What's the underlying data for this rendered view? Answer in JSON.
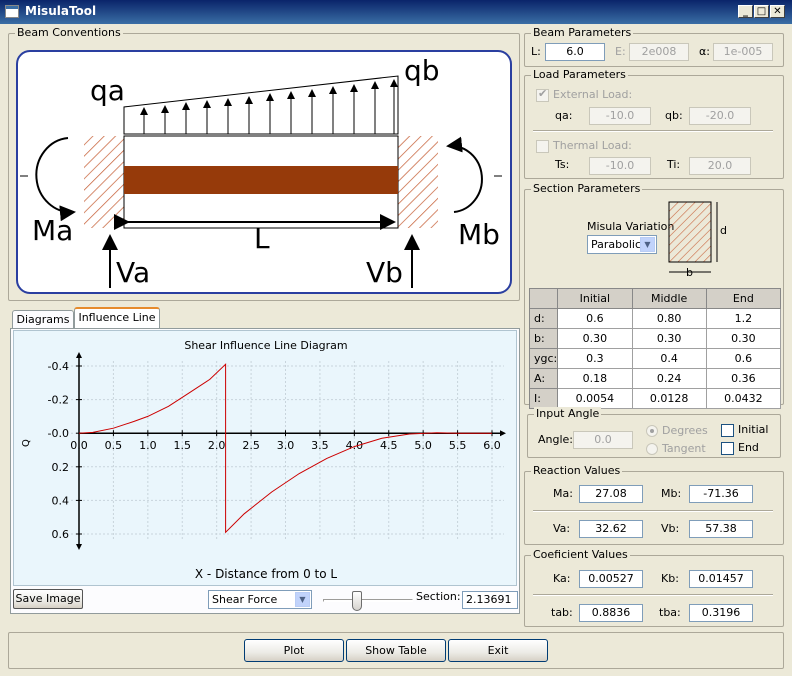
{
  "window": {
    "title": "MisulaTool"
  },
  "conventions": {
    "group_title": "Beam Conventions",
    "labels": {
      "qa": "qa",
      "qb": "qb",
      "Ma": "Ma",
      "Mb": "Mb",
      "L": "L",
      "Va": "Va",
      "Vb": "Vb"
    }
  },
  "tabs": [
    {
      "label": "Diagrams"
    },
    {
      "label": "Influence Line"
    }
  ],
  "chart_data": {
    "type": "line",
    "title": "Shear Influence Line Diagram",
    "xlabel": "X - Distance from 0 to L",
    "ylabel": "Q",
    "xlim": [
      0,
      6.0
    ],
    "ylim": [
      -0.4,
      0.6
    ],
    "y_inverted": true,
    "xticks": [
      0.0,
      0.5,
      1.0,
      1.5,
      2.0,
      2.5,
      3.0,
      3.5,
      4.0,
      4.5,
      5.0,
      5.5,
      6.0
    ],
    "xtick_labels": [
      "0.0",
      "0.5",
      "1.0",
      "1.5",
      "2.0",
      "2.5",
      "3.0",
      "3.5",
      "4.0",
      "4.5",
      "5.0",
      "5.5",
      "6.0"
    ],
    "yticks": [
      -0.4,
      -0.2,
      0.0,
      0.2,
      0.4,
      0.6
    ],
    "ytick_labels": [
      "-0.4",
      "-0.2",
      "-0.0",
      "0.2",
      "0.4",
      "0.6"
    ],
    "grid": true,
    "line_color": "#cc0000",
    "series": [
      {
        "x": [
          0.0,
          0.2,
          0.5,
          0.8,
          1.0,
          1.3,
          1.6,
          1.9,
          2.13,
          2.13,
          2.4,
          2.8,
          3.2,
          3.6,
          4.0,
          4.4,
          4.8,
          5.2,
          5.5,
          6.0
        ],
        "y": [
          0.0,
          -0.005,
          -0.03,
          -0.07,
          -0.1,
          -0.16,
          -0.24,
          -0.32,
          -0.41,
          0.59,
          0.48,
          0.35,
          0.24,
          0.15,
          0.08,
          0.03,
          0.005,
          -0.003,
          0.0,
          0.0
        ]
      }
    ]
  },
  "bottom_controls": {
    "save_image": "Save Image",
    "force_select": "Shear Force",
    "section_label": "Section:",
    "section_value": "2.13691",
    "slider_fraction": 0.36
  },
  "beam_params": {
    "title": "Beam Parameters",
    "L_label": "L:",
    "L_value": "6.0",
    "E_label": "E:",
    "E_value": "2e008",
    "alpha_label": "α:",
    "alpha_value": "1e-005"
  },
  "load_params": {
    "title": "Load Parameters",
    "external_label": "External Load:",
    "qa_label": "qa:",
    "qa_value": "-10.0",
    "qb_label": "qb:",
    "qb_value": "-20.0",
    "thermal_label": "Thermal  Load:",
    "ts_label": "Ts:",
    "ts_value": "-10.0",
    "ti_label": "Ti:",
    "ti_value": "20.0"
  },
  "section_params": {
    "title": "Section Parameters",
    "variation_label": "Misula Variation",
    "variation_value": "Parabolic",
    "dim_d": "d",
    "dim_b": "b",
    "table": {
      "headers": [
        "",
        "Initial",
        "Middle",
        "End"
      ],
      "rows": [
        [
          "d:",
          "0.6",
          "0.80",
          "1.2"
        ],
        [
          "b:",
          "0.30",
          "0.30",
          "0.30"
        ],
        [
          "ygc:",
          "0.3",
          "0.4",
          "0.6"
        ],
        [
          "A:",
          "0.18",
          "0.24",
          "0.36"
        ],
        [
          "I:",
          "0.0054",
          "0.0128",
          "0.0432"
        ]
      ]
    }
  },
  "input_angle": {
    "title": "Input Angle",
    "angle_label": "Angle:",
    "angle_value": "0.0",
    "degrees_label": "Degrees",
    "tangent_label": "Tangent",
    "initial_label": "Initial",
    "end_label": "End"
  },
  "reactions": {
    "title": "Reaction Values",
    "Ma_label": "Ma:",
    "Ma_value": "27.08",
    "Mb_label": "Mb:",
    "Mb_value": "-71.36",
    "Va_label": "Va:",
    "Va_value": "32.62",
    "Vb_label": "Vb:",
    "Vb_value": "57.38"
  },
  "coefficients": {
    "title": "Coeficient Values",
    "Ka_label": "Ka:",
    "Ka_value": "0.00527",
    "Kb_label": "Kb:",
    "Kb_value": "0.01457",
    "tab_label": "tab:",
    "tab_value": "0.8836",
    "tba_label": "tba:",
    "tba_value": "0.3196"
  },
  "footer": {
    "plot": "Plot",
    "show_table": "Show Table",
    "exit": "Exit"
  }
}
